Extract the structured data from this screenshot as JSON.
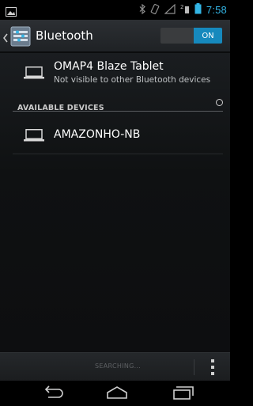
{
  "status_bar": {
    "time": "7:58",
    "icons": [
      "gallery-notification-icon",
      "bluetooth-icon",
      "vibrate-icon",
      "signal-icon",
      "data-2g-icon",
      "battery-icon"
    ],
    "accent_color": "#33b5e5"
  },
  "action_bar": {
    "title": "Bluetooth",
    "icon": "bluetooth-settings-icon",
    "toggle_label": "ON",
    "toggle_state": true
  },
  "local_device": {
    "icon": "laptop-icon",
    "name": "OMAP4 Blaze Tablet",
    "status": "Not visible to other Bluetooth devices"
  },
  "available_section": {
    "title": "AVAILABLE DEVICES",
    "icon": "progress-spinner-icon"
  },
  "available_devices": [
    {
      "icon": "laptop-icon",
      "name": "AMAZONHO-NB"
    }
  ],
  "bottom_bar": {
    "search_label": "SEARCHING...",
    "overflow_icon": "overflow-menu-icon"
  },
  "nav_bar": {
    "icons": [
      "back-icon",
      "home-icon",
      "recents-icon"
    ]
  }
}
